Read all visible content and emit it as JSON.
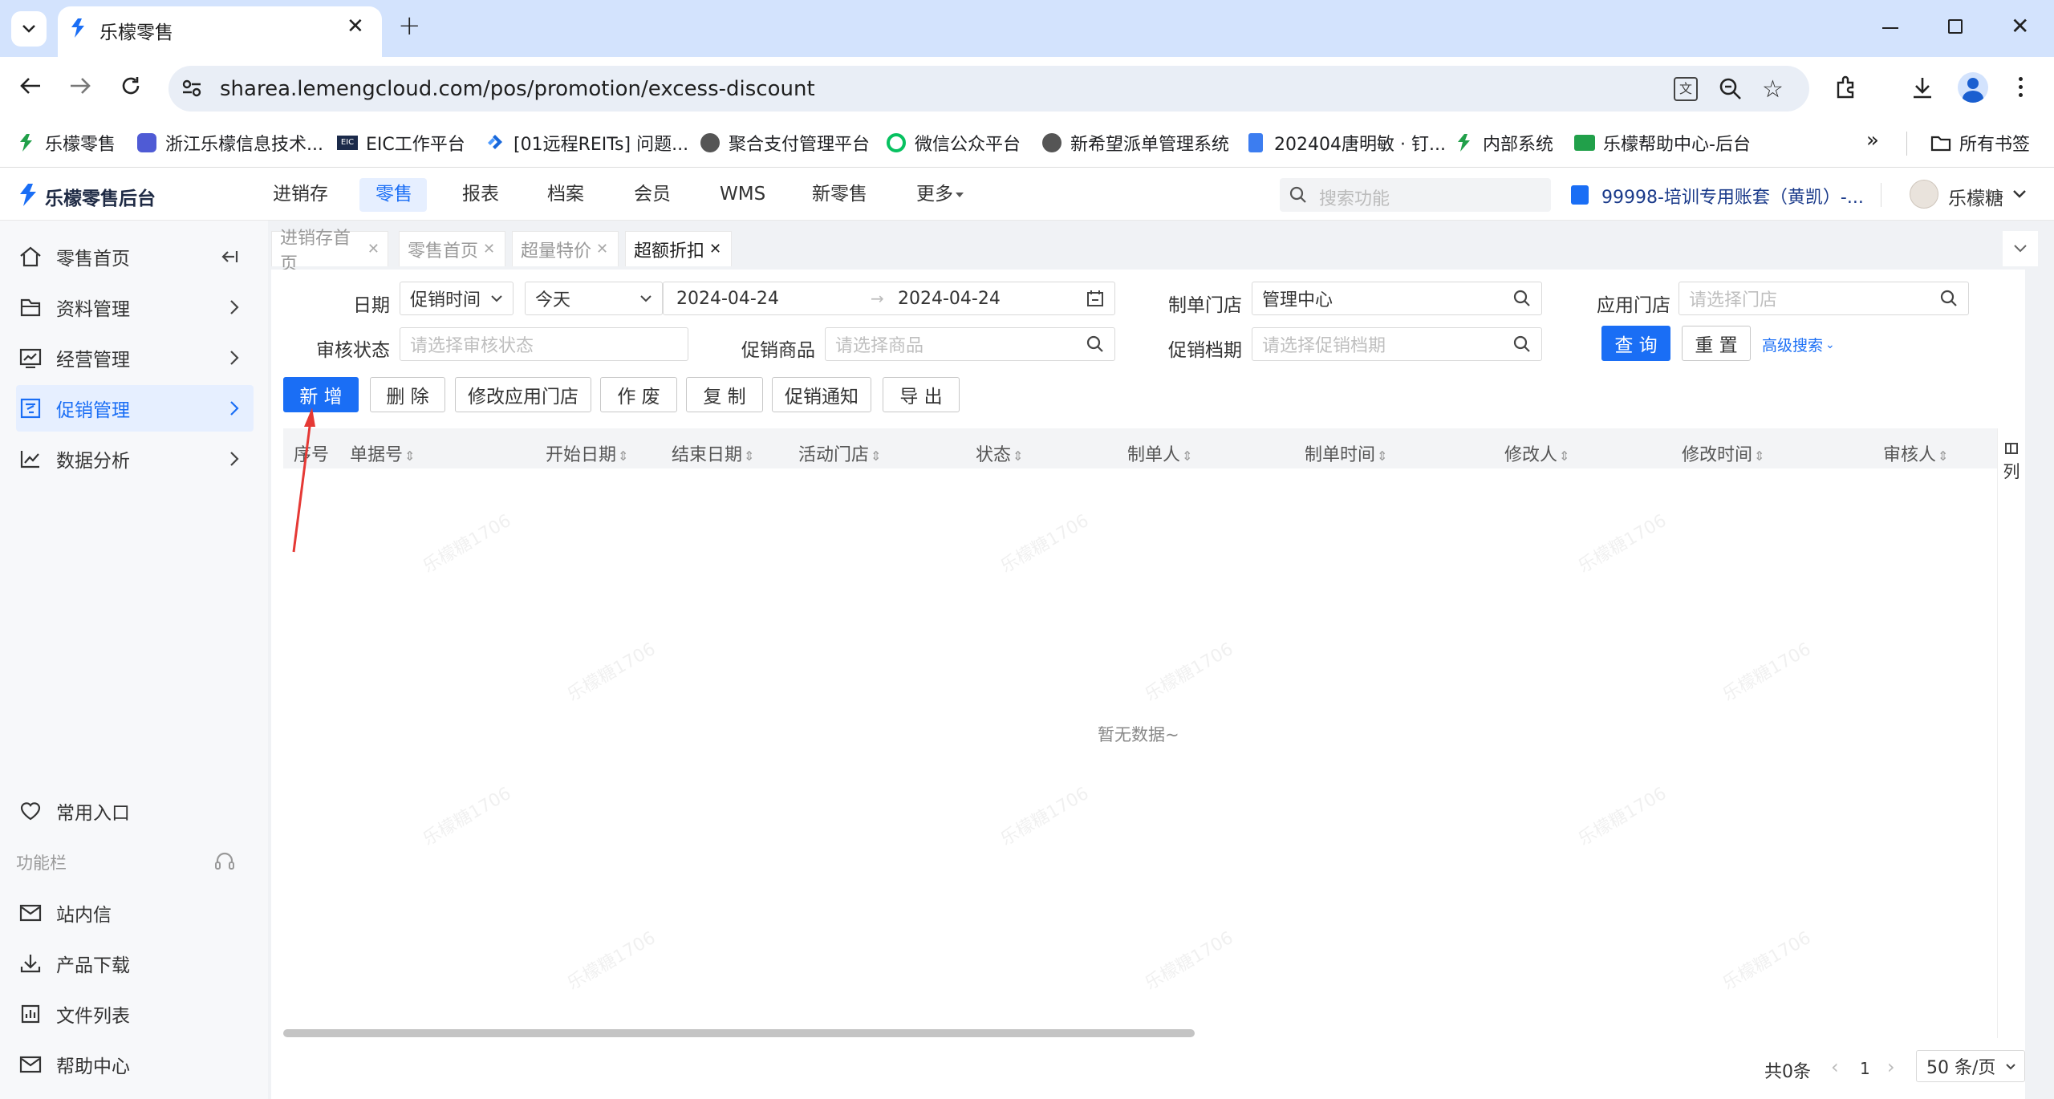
{
  "browser": {
    "tab_title": "乐檬零售",
    "url": "sharea.lemengcloud.com/pos/promotion/excess-discount",
    "bookmarks": [
      "乐檬零售",
      "浙江乐檬信息技术...",
      "EIC工作平台",
      "[01远程REITs] 问题...",
      "聚合支付管理平台",
      "微信公众平台",
      "新希望派单管理系统",
      "202404唐明敏 · 钉...",
      "内部系统",
      "乐檬帮助中心-后台"
    ],
    "all_bookmarks": "所有书签"
  },
  "header": {
    "logo": "乐檬零售后台",
    "nav": [
      "进销存",
      "零售",
      "报表",
      "档案",
      "会员",
      "WMS",
      "新零售",
      "更多"
    ],
    "search_placeholder": "搜索功能",
    "account": "99998-培训专用账套（黄凯）-...",
    "user": "乐檬糖"
  },
  "sidebar": {
    "items": [
      "零售首页",
      "资料管理",
      "经营管理",
      "促销管理",
      "数据分析"
    ],
    "bottom": [
      "常用入口"
    ],
    "section": "功能栏",
    "tools": [
      "站内信",
      "产品下载",
      "文件列表",
      "帮助中心"
    ]
  },
  "page_tabs": [
    "进销存首页",
    "零售首页",
    "超量特价",
    "超额折扣"
  ],
  "filters": {
    "date_label": "日期",
    "date_type": "促销时间",
    "date_range": "今天",
    "date_from": "2024-04-24",
    "date_to": "2024-04-24",
    "store_label": "制单门店",
    "store_value": "管理中心",
    "apply_store_label": "应用门店",
    "apply_store_placeholder": "请选择门店",
    "audit_label": "审核状态",
    "audit_placeholder": "请选择审核状态",
    "goods_label": "促销商品",
    "goods_placeholder": "请选择商品",
    "period_label": "促销档期",
    "period_placeholder": "请选择促销档期",
    "query": "查 询",
    "reset": "重 置",
    "advanced": "高级搜索"
  },
  "actions": [
    "新 增",
    "删 除",
    "修改应用门店",
    "作 废",
    "复 制",
    "促销通知",
    "导 出"
  ],
  "table": {
    "columns": [
      "序号",
      "单据号",
      "开始日期",
      "结束日期",
      "活动门店",
      "状态",
      "制单人",
      "制单时间",
      "修改人",
      "修改时间",
      "审核人"
    ],
    "empty": "暂无数据~",
    "col_setting": "列"
  },
  "pagination": {
    "total": "共0条",
    "page": "1",
    "page_size": "50 条/页"
  },
  "watermark": "乐檬糖1706",
  "colors": {
    "primary": "#1a6ef5",
    "arrow": "#e53935"
  }
}
